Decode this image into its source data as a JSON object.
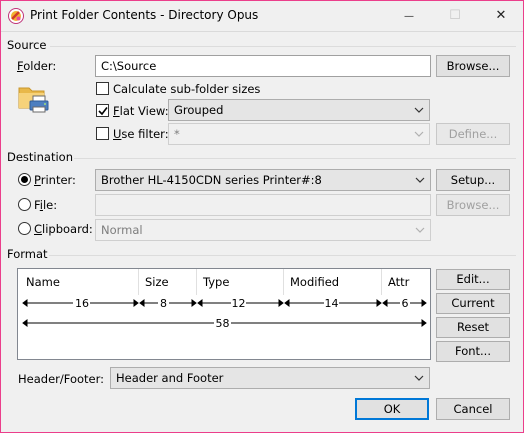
{
  "window": {
    "title": "Print Folder Contents - Directory Opus",
    "minimize_glyph": "—",
    "maximize_glyph": "☐",
    "close_glyph": "✕"
  },
  "source": {
    "section_label": "Source",
    "folder_label": "Folder:",
    "folder_value": "C:\\Source",
    "browse_label": "Browse...",
    "calc_subfolder_label": "Calculate sub-folder sizes",
    "calc_subfolder_checked": false,
    "flat_view_label": "Flat View:",
    "flat_view_checked": true,
    "flat_view_value": "Grouped",
    "use_filter_label": "Use filter:",
    "use_filter_checked": false,
    "filter_value": "*",
    "define_label": "Define..."
  },
  "destination": {
    "section_label": "Destination",
    "selected": "printer",
    "printer_label": "Printer:",
    "printer_value": "Brother HL-4150CDN series Printer#:8",
    "setup_label": "Setup...",
    "file_label": "File:",
    "file_value": "",
    "file_browse_label": "Browse...",
    "clipboard_label": "Clipboard:",
    "clipboard_value": "Normal"
  },
  "format": {
    "section_label": "Format",
    "columns": [
      {
        "name": "Name",
        "width": "16"
      },
      {
        "name": "Size",
        "width": "8"
      },
      {
        "name": "Type",
        "width": "12"
      },
      {
        "name": "Modified",
        "width": "14"
      },
      {
        "name": "Attr",
        "width": "6"
      }
    ],
    "total_width": "58",
    "edit_label": "Edit...",
    "current_label": "Current",
    "reset_label": "Reset",
    "font_label": "Font...",
    "header_footer_label": "Header/Footer:",
    "header_footer_value": "Header and Footer"
  },
  "footer": {
    "ok_label": "OK",
    "cancel_label": "Cancel"
  },
  "colors": {
    "accent": "#0078d7",
    "window_border": "#eb3e8b",
    "background": "#f0f0f0"
  },
  "icons": [
    "app-icon",
    "minimize-icon",
    "maximize-icon",
    "close-icon",
    "folder-printer-icon",
    "checkmark-icon",
    "chevron-down-icon"
  ]
}
